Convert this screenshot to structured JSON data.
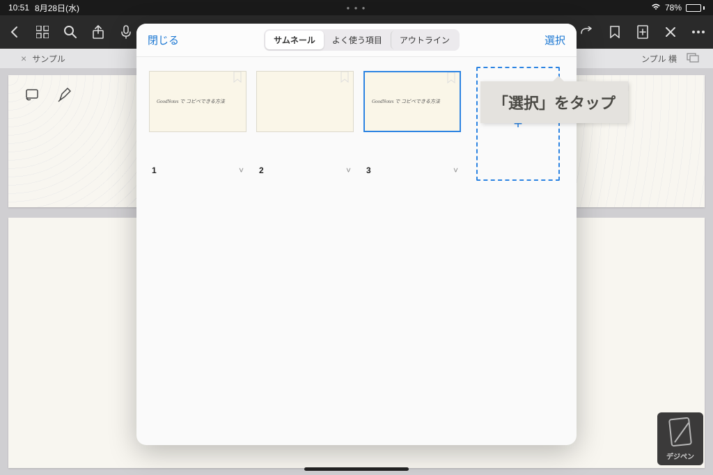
{
  "status": {
    "time": "10:51",
    "date": "8月28日(水)",
    "battery_pct": "78%"
  },
  "tabbar": {
    "left_label": "サンプル",
    "right_label": "ンプル 横"
  },
  "modal": {
    "close_label": "閉じる",
    "select_label": "選択",
    "segments": {
      "thumbnail": "サムネール",
      "favorites": "よく使う項目",
      "outline": "アウトライン"
    },
    "pages": [
      {
        "num": "1",
        "text": "GoodNotes で コピペできる方法"
      },
      {
        "num": "2",
        "text": ""
      },
      {
        "num": "3",
        "text": "GoodNotes で コピペできる方法"
      }
    ],
    "add_label": "+"
  },
  "callout": {
    "text": "「選択」をタップ"
  },
  "watermark": {
    "label": "デジペン"
  }
}
